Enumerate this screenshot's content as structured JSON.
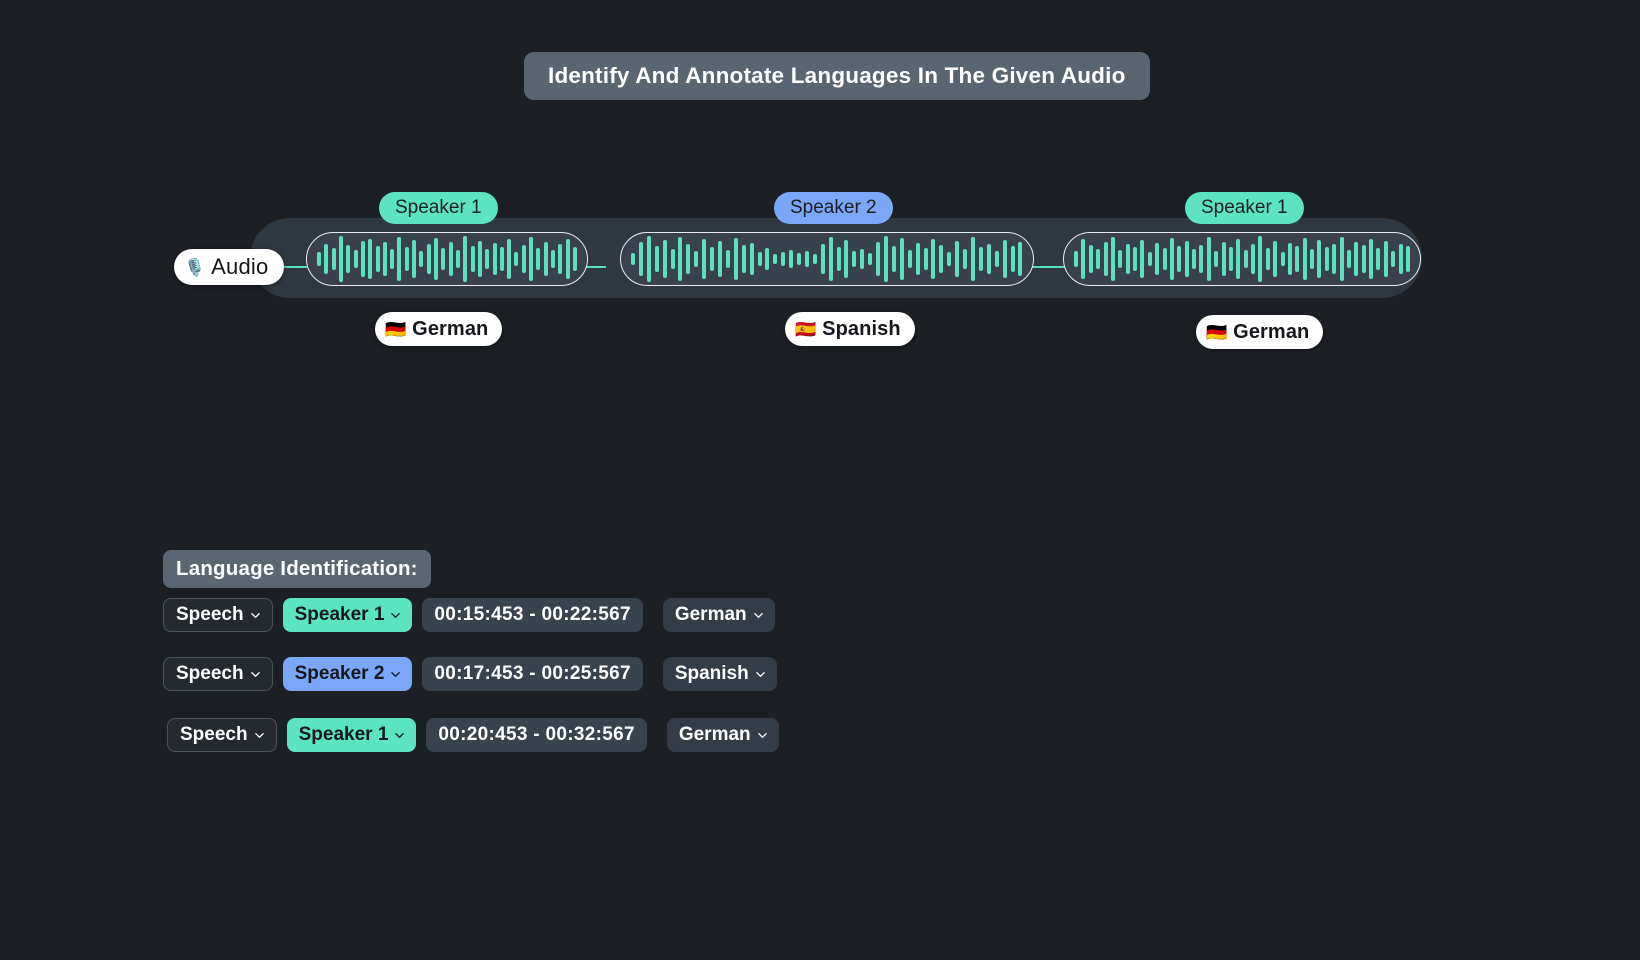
{
  "title": "Identify And Annotate Languages In The Given Audio",
  "audio": {
    "label": "Audio",
    "mic_icon": "microphone-icon"
  },
  "colors": {
    "background": "#1c1f24",
    "speaker1": "#5ce3c0",
    "speaker2": "#7aa7f8",
    "wave": "#5fe0bd",
    "pill": "#596570",
    "track": "#2f3740",
    "segment": "#39424c"
  },
  "segments": [
    {
      "speaker": "Speaker 1",
      "speaker_color": "#5ce3c0",
      "language": "German",
      "flag": "🇩🇪"
    },
    {
      "speaker": "Speaker 2",
      "speaker_color": "#7aa7f8",
      "language": "Spanish",
      "flag": "🇪🇸"
    },
    {
      "speaker": "Speaker 1",
      "speaker_color": "#5ce3c0",
      "language": "German",
      "flag": "🇩🇪"
    }
  ],
  "identification": {
    "heading": "Language Identification:",
    "rows": [
      {
        "type": "Speech",
        "speaker": "Speaker 1",
        "speaker_color": "#5ce3c0",
        "time": "00:15:453 - 00:22:567",
        "language": "German"
      },
      {
        "type": "Speech",
        "speaker": "Speaker 2",
        "speaker_color": "#7aa7f8",
        "time": "00:17:453 - 00:25:567",
        "language": "Spanish"
      },
      {
        "type": "Speech",
        "speaker": "Speaker 1",
        "speaker_color": "#5ce3c0",
        "time": "00:20:453 - 00:32:567",
        "language": "German"
      }
    ]
  },
  "waveforms": {
    "seg1": [
      14,
      30,
      22,
      46,
      28,
      18,
      36,
      40,
      26,
      34,
      20,
      44,
      24,
      38,
      16,
      30,
      42,
      22,
      34,
      18,
      46,
      26,
      36,
      20,
      32,
      24,
      40,
      14,
      28,
      44,
      22,
      34,
      18,
      30,
      40,
      24
    ],
    "seg2": [
      12,
      34,
      46,
      26,
      38,
      20,
      44,
      30,
      16,
      40,
      24,
      36,
      18,
      42,
      28,
      32,
      14,
      22,
      10,
      14,
      18,
      12,
      16,
      10,
      30,
      44,
      24,
      38,
      16,
      20,
      12,
      34,
      46,
      26,
      42,
      18,
      32,
      22,
      40,
      28,
      14,
      36,
      20,
      44,
      24,
      30,
      16,
      38,
      26,
      34
    ],
    "seg3": [
      16,
      40,
      28,
      20,
      34,
      44,
      18,
      30,
      24,
      38,
      14,
      32,
      22,
      42,
      26,
      36,
      20,
      28,
      44,
      16,
      34,
      24,
      40,
      18,
      30,
      46,
      22,
      36,
      14,
      32,
      26,
      42,
      20,
      38,
      24,
      30,
      44,
      18,
      34,
      28,
      40,
      22,
      36,
      16,
      30,
      26
    ],
    "tail": [
      18,
      34,
      26,
      14
    ]
  }
}
